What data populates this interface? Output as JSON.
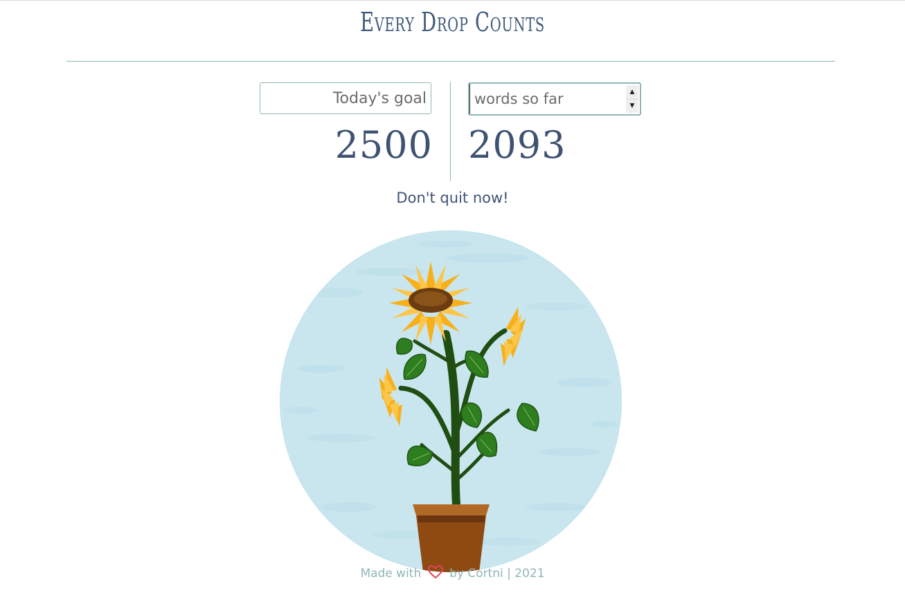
{
  "header": {
    "title": "Every Drop Counts"
  },
  "goal": {
    "placeholder": "Today's goal",
    "value": "2500"
  },
  "words": {
    "placeholder": "words so far",
    "value": "2093"
  },
  "message": "Don't quit now!",
  "footer": {
    "made_with": "Made with",
    "by": "by Cortni | 2021",
    "heart_icon": "heart-icon"
  },
  "colors": {
    "accent": "#8fb5b5",
    "text": "#3f5272",
    "sky": "#c9e6ee",
    "heart": "#e0455f"
  }
}
